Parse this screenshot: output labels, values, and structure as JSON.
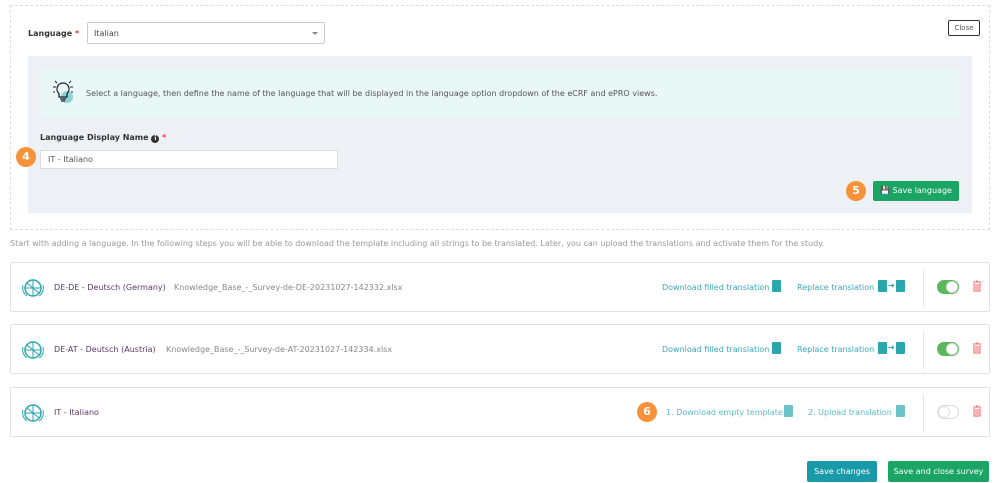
{
  "form": {
    "language_label": "Language",
    "required": "*",
    "language_value": "Italian",
    "close_label": "Close",
    "info_text": "Select a language, then define the name of the language that will be displayed in the language option dropdown of the eCRF and ePRO views.",
    "display_name_label": "Language Display Name",
    "display_name_value": "IT - Italiano",
    "save_language_label": "Save language"
  },
  "badges": [
    "4",
    "5",
    "6"
  ],
  "intro_text": "Start with adding a language. In the following steps you will be able to download the template including all strings to be translated. Later, you can upload the translations and activate them for the study.",
  "languages": [
    {
      "name": "DE-DE - Deutsch (Germany)",
      "file": "Knowledge_Base_-_Survey-de-DE-20231027-142332.xlsx",
      "download": "Download filled translation",
      "replace": "Replace translation",
      "active": true
    },
    {
      "name": "DE-AT - Deutsch (Austria)",
      "file": "Knowledge_Base_-_Survey-de-AT-20231027-142334.xlsx",
      "download": "Download filled translation",
      "replace": "Replace translation",
      "active": true
    },
    {
      "name": "IT - Italiano",
      "download": "1. Download empty template",
      "upload": "2. Upload translation",
      "active": false
    }
  ],
  "footer": {
    "save_changes": "Save changes",
    "save_close": "Save and close survey"
  },
  "colors": {
    "green": "#1aa564",
    "teal": "#1a9aa8",
    "badge": "#f7923a",
    "toggle_on": "#5cb85c",
    "trash": "#f08080"
  }
}
